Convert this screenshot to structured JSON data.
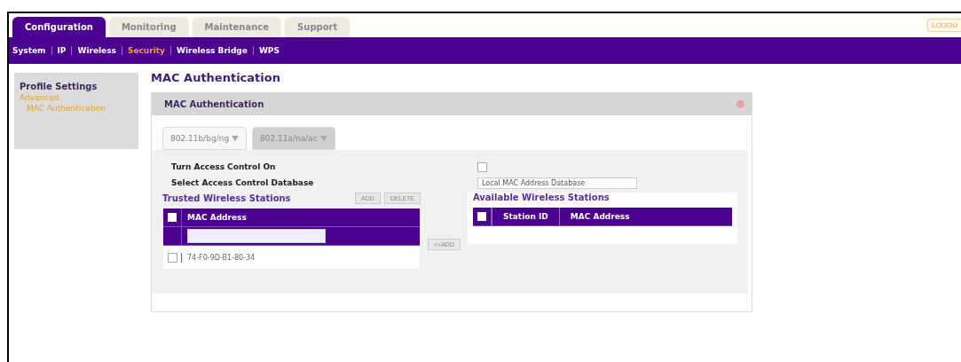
{
  "top_tabs": [
    {
      "label": "Configuration",
      "selected": true
    },
    {
      "label": "Monitoring",
      "selected": false
    },
    {
      "label": "Maintenance",
      "selected": false
    },
    {
      "label": "Support",
      "selected": false
    }
  ],
  "logout_button": "LOGOU",
  "sub_nav": [
    {
      "label": "System",
      "selected": false
    },
    {
      "label": "IP",
      "selected": false
    },
    {
      "label": "Wireless",
      "selected": false
    },
    {
      "label": "Security",
      "selected": true
    },
    {
      "label": "Wireless Bridge",
      "selected": false
    },
    {
      "label": "WPS",
      "selected": false
    }
  ],
  "sidebar": {
    "title": "Profile Settings",
    "items": [
      {
        "label": "Advanced",
        "selected": true,
        "children": [
          {
            "label": "MAC Authentication",
            "selected": true
          }
        ]
      }
    ]
  },
  "page_title": "MAC Authentication",
  "panel": {
    "title": "MAC Authentication",
    "radio_tabs": [
      {
        "label": "802.11b/bg/ng",
        "selected": true
      },
      {
        "label": "802.11a/na/ac",
        "selected": false
      }
    ],
    "turn_access_control": {
      "label": "Turn Access Control On",
      "checked": false
    },
    "database": {
      "label": "Select Access Control Database",
      "value": "Local MAC Address Database"
    },
    "trusted": {
      "title": "Trusted Wireless Stations",
      "buttons": [
        "ADD",
        "DELETE"
      ],
      "select_all_checked": false,
      "columns": [
        "MAC Address"
      ],
      "rows": [
        {
          "mac": "74-F0-9D-B1-80-34",
          "checked": false
        }
      ]
    },
    "move_button": "<<ADD",
    "available": {
      "title": "Available Wireless Stations",
      "select_all_checked": false,
      "columns": [
        "Station ID",
        "MAC Address"
      ]
    }
  }
}
